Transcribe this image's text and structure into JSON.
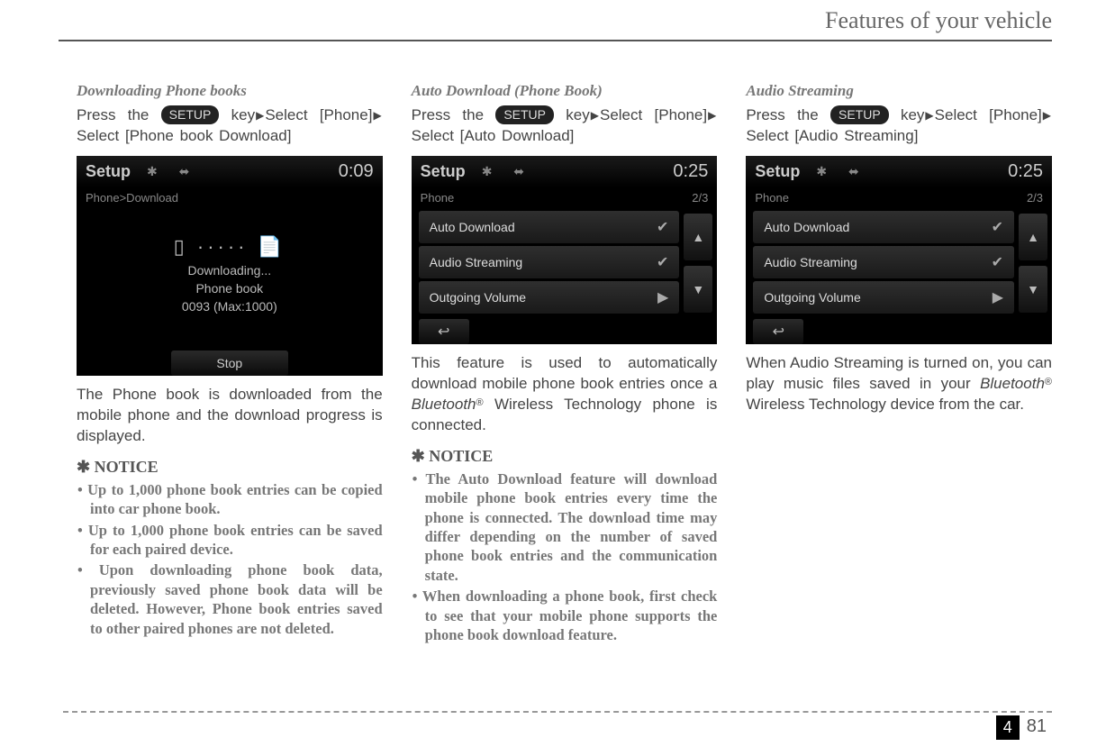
{
  "header": {
    "title": "Features of your vehicle"
  },
  "setup_label": "SETUP",
  "col1": {
    "heading": "Downloading Phone books",
    "instr_pre": "Press the ",
    "instr_post1": " key",
    "instr_post2": "Select [Phone]",
    "instr_post3": "Select [Phone book Download]",
    "screen": {
      "title": "Setup",
      "time": "0:09",
      "sub": "Phone>Download",
      "dl_main": "Downloading...",
      "dl_line2": "Phone book",
      "dl_line3": "0093 (Max:1000)",
      "stop": "Stop"
    },
    "after": "The Phone book is downloaded from the mobile phone and the download progress is displayed.",
    "notice_heading": "✱ NOTICE",
    "notice": [
      "Up to 1,000 phone book entries can be copied into car phone book.",
      "Up to 1,000 phone book entries can be saved for each paired device.",
      "Upon downloading phone book data, previously saved phone book data will be deleted. However, Phone book entries saved to other paired phones are not deleted."
    ]
  },
  "col2": {
    "heading": "Auto Download (Phone Book)",
    "instr_pre": "Press the ",
    "instr_post1": " key",
    "instr_post2": "Select [Phone]",
    "instr_post3": "Select [Auto Download]",
    "screen": {
      "title": "Setup",
      "time": "0:25",
      "sub": "Phone",
      "page": "2/3",
      "rows": [
        {
          "label": "Auto Download",
          "type": "check"
        },
        {
          "label": "Audio Streaming",
          "type": "check"
        },
        {
          "label": "Outgoing Volume",
          "type": "arrow"
        }
      ]
    },
    "after_pre": "This feature is used to automatically download mobile phone book entries once a ",
    "after_bt": "Bluetooth",
    "after_post": " Wireless Technology phone is connected.",
    "notice_heading": "✱ NOTICE",
    "notice": [
      "The Auto Download feature will download mobile phone book entries every time the phone is connected. The download time may differ depending on the number of saved phone book entries and the communication state.",
      "When downloading a phone book, first check to see that your mobile phone supports the phone book download feature."
    ]
  },
  "col3": {
    "heading": "Audio Streaming",
    "instr_pre": "Press the ",
    "instr_post1": " key",
    "instr_post2": "Select [Phone]",
    "instr_post3": "Select [Audio Streaming]",
    "screen": {
      "title": "Setup",
      "time": "0:25",
      "sub": "Phone",
      "page": "2/3",
      "rows": [
        {
          "label": "Auto Download",
          "type": "check"
        },
        {
          "label": "Audio Streaming",
          "type": "check"
        },
        {
          "label": "Outgoing Volume",
          "type": "arrow"
        }
      ]
    },
    "after_pre": "When Audio Streaming is turned on, you can play music files saved in your ",
    "after_bt": "Bluetooth",
    "after_post": " Wireless Technology device from the car."
  },
  "footer": {
    "section": "4",
    "page": "81"
  }
}
